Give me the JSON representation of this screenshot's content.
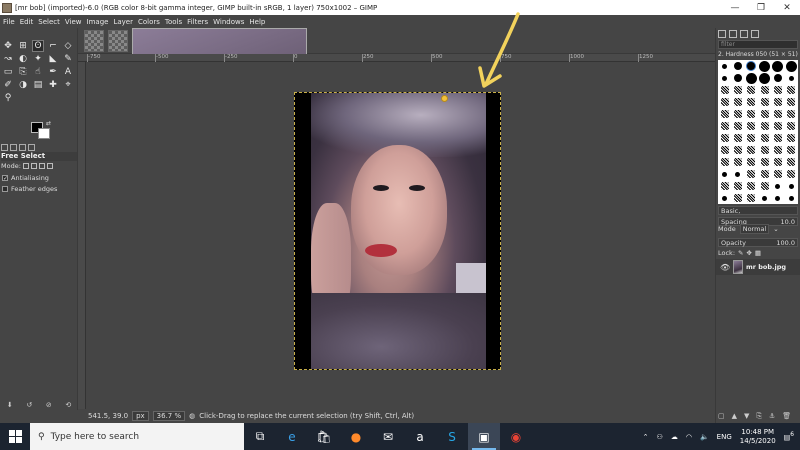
{
  "window": {
    "title": "[mr bob] (imported)-6.0 (RGB color 8-bit gamma integer, GIMP built-in sRGB, 1 layer) 750x1002 – GIMP",
    "controls": [
      "—",
      "❐",
      "✕"
    ]
  },
  "menu": [
    "File",
    "Edit",
    "Select",
    "View",
    "Image",
    "Layer",
    "Colors",
    "Tools",
    "Filters",
    "Windows",
    "Help"
  ],
  "tool_options": {
    "title": "Free Select",
    "mode_label": "Mode:",
    "antialiasing": "Antialiasing",
    "feather": "Feather edges"
  },
  "ruler": {
    "h_ticks": [
      "-750",
      "-500",
      "-250",
      "0",
      "250",
      "500",
      "750",
      "1000",
      "1250"
    ]
  },
  "status": {
    "coords": "541.5, 39.0",
    "unit": "px",
    "zoom": "36.7 %",
    "message": "Click-Drag to replace the current selection (try Shift, Ctrl, Alt)"
  },
  "brushes": {
    "filter_placeholder": "filter",
    "current": "2. Hardness 050 (51 × 51)",
    "preset": "Basic,",
    "spacing_label": "Spacing",
    "spacing_value": "10.0"
  },
  "layers": {
    "mode_label": "Mode",
    "mode_value": "Normal",
    "opacity_label": "Opacity",
    "opacity_value": "100.0",
    "lock_label": "Lock:",
    "items": [
      {
        "name": "mr bob.jpg"
      }
    ]
  },
  "taskbar": {
    "search_placeholder": "Type here to search",
    "lang": "ENG",
    "time": "10:48 PM",
    "date": "14/5/2020",
    "notif_count": "6"
  }
}
